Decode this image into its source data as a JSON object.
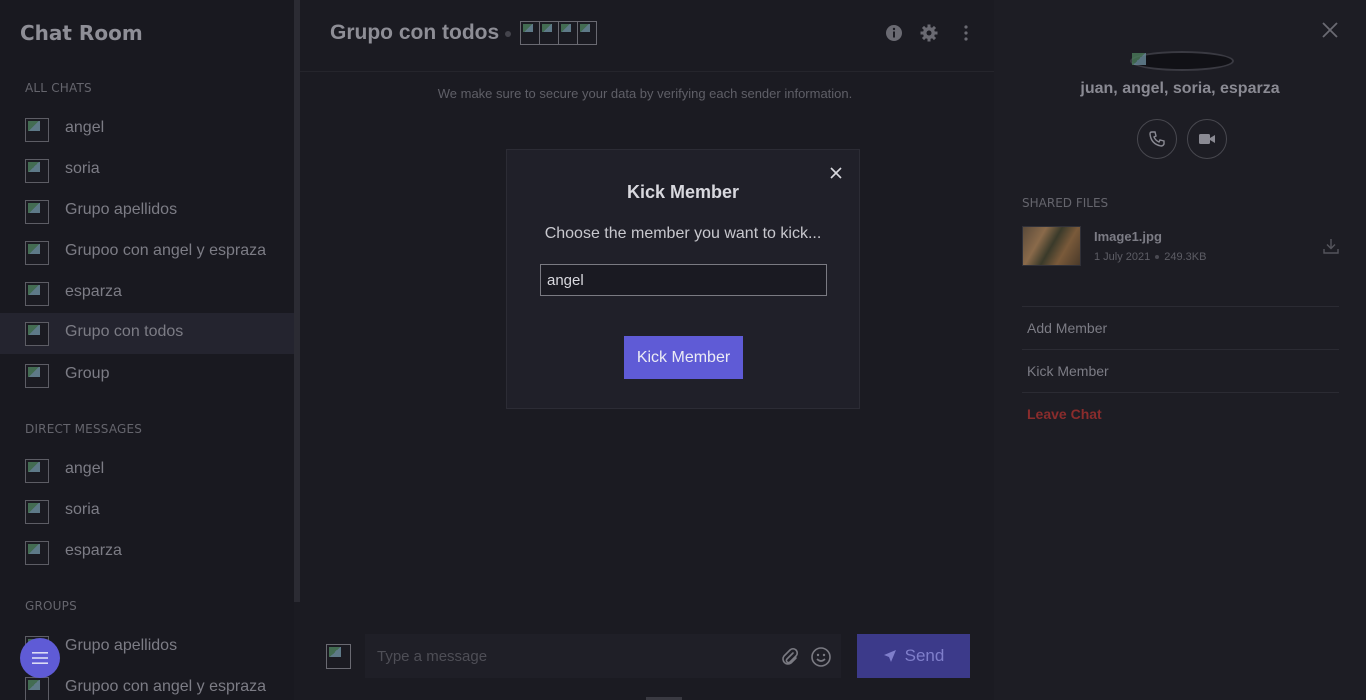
{
  "sidebar": {
    "title": "Chat Room",
    "all_chats_label": "ALL CHATS",
    "all_chats": [
      {
        "name": "angel"
      },
      {
        "name": "soria"
      },
      {
        "name": "Grupo apellidos"
      },
      {
        "name": "Grupoo con angel y espraza"
      },
      {
        "name": "esparza"
      },
      {
        "name": "Grupo con todos",
        "active": true
      },
      {
        "name": "Group"
      }
    ],
    "direct_messages_label": "DIRECT MESSAGES",
    "direct_messages": [
      {
        "name": "angel"
      },
      {
        "name": "soria"
      },
      {
        "name": "esparza"
      }
    ],
    "groups_label": "GROUPS",
    "groups": [
      {
        "name": "Grupo apellidos"
      },
      {
        "name": "Grupoo con angel y espraza"
      }
    ],
    "fab_icon": "menu-icon"
  },
  "main": {
    "title": "Grupo con todos",
    "member_avatar_count": 4,
    "secure_note": "We make sure to secure your data by verifying each sender information.",
    "header_icons": [
      "info-icon",
      "settings-icon",
      "more-vertical-icon"
    ],
    "composer": {
      "placeholder": "Type a message",
      "send_label": "Send"
    }
  },
  "modal": {
    "title": "Kick Member",
    "prompt": "Choose the member you want to kick...",
    "input_value": "angel",
    "button_label": "Kick Member"
  },
  "details": {
    "members": "juan, angel, soria, esparza",
    "shared_files_label": "SHARED FILES",
    "file": {
      "name": "Image1.jpg",
      "date": "1 July 2021",
      "size": "249.3KB"
    },
    "actions": {
      "add_member": "Add Member",
      "kick_member": "Kick Member",
      "leave_chat": "Leave Chat"
    }
  },
  "colors": {
    "accent": "#5f5bd6",
    "danger": "#8a2c2c",
    "background": "#1b1b22"
  }
}
